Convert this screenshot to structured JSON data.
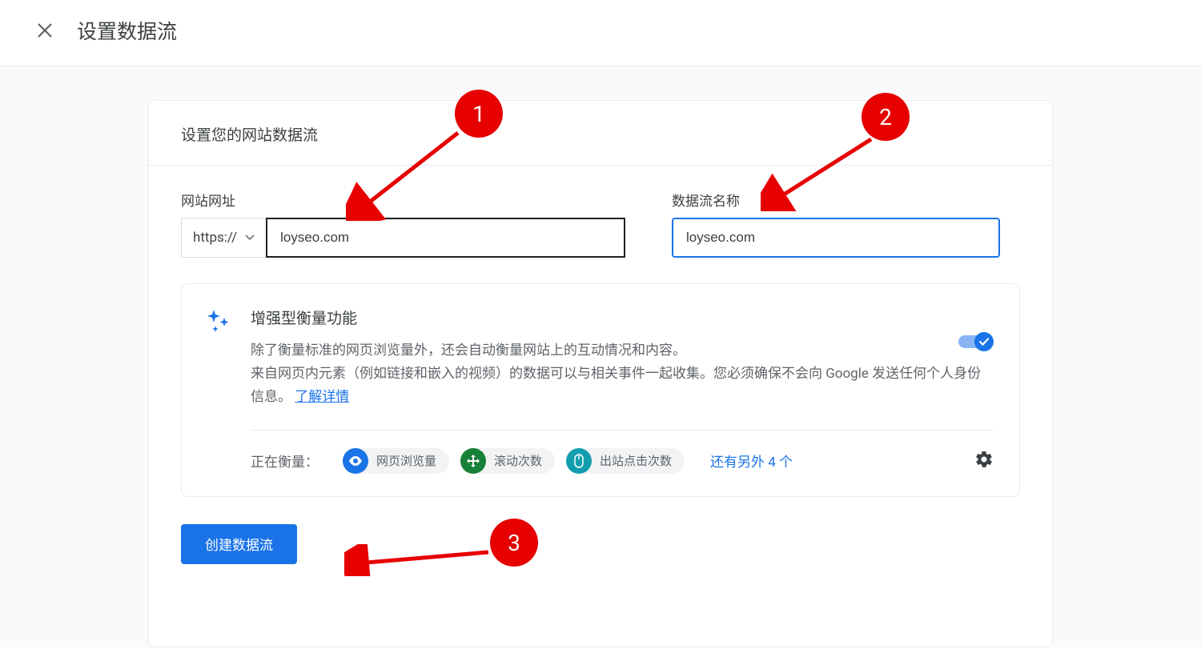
{
  "header": {
    "title": "设置数据流"
  },
  "card": {
    "heading": "设置您的网站数据流",
    "urlLabel": "网站网址",
    "protocol": "https://",
    "urlValue": "loyseo.com",
    "nameLabel": "数据流名称",
    "nameValue": "loyseo.com",
    "enhanced": {
      "title": "增强型衡量功能",
      "desc1": "除了衡量标准的网页浏览量外，还会自动衡量网站上的互动情况和内容。",
      "desc2": "来自网页内元素（例如链接和嵌入的视频）的数据可以与相关事件一起收集。您必须确保不会向 Google 发送任何个人身份信息。",
      "learnMore": "了解详情",
      "measuringLabel": "正在衡量：",
      "chips": [
        {
          "label": "网页浏览量",
          "color": "blue"
        },
        {
          "label": "滚动次数",
          "color": "green"
        },
        {
          "label": "出站点击次数",
          "color": "teal"
        }
      ],
      "moreText": "还有另外 4 个"
    },
    "createButton": "创建数据流"
  },
  "annotations": {
    "n1": "1",
    "n2": "2",
    "n3": "3"
  }
}
